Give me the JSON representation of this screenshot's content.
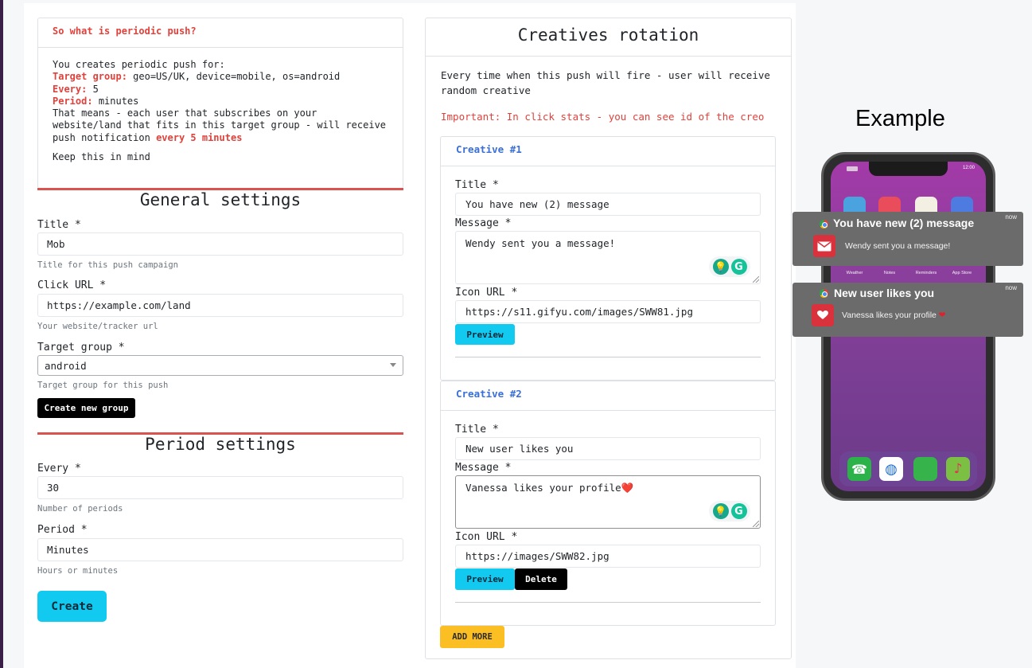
{
  "info": {
    "header": "So what is periodic push?",
    "line1": "You creates periodic push for:",
    "target_label": "Target group:",
    "target_value": "geo=US/UK, device=mobile, os=android",
    "every_label": "Every:",
    "every_value": "5",
    "period_label": "Period:",
    "period_value": "minutes",
    "means_text": "That means - each user that subscribes on your website/land that fits in this target group - will receive push notification",
    "means_highlight": "every 5 minutes",
    "keep": "Keep this in mind"
  },
  "general": {
    "heading": "General settings",
    "title_label": "Title *",
    "title_value": "Mob",
    "title_hint": "Title for this push campaign",
    "url_label": "Click URL *",
    "url_value": "https://example.com/land",
    "url_hint": "Your website/tracker url",
    "group_label": "Target group *",
    "group_value": "android",
    "group_hint": "Target group for this push",
    "create_group_button": "Create new group"
  },
  "period": {
    "heading": "Period settings",
    "every_label": "Every *",
    "every_value": "30",
    "every_hint": "Number of periods",
    "period_label": "Period *",
    "period_value": "Minutes",
    "period_hint": "Hours or minutes",
    "create_button": "Create"
  },
  "rotation": {
    "heading": "Creatives rotation",
    "description": "Every time when this push will fire - user will receive random creative",
    "important": "Important: In click stats - you can see id of the creo",
    "creatives": [
      {
        "header": "Creative #1",
        "title_label": "Title *",
        "title_value": "You have new (2) message",
        "message_label": "Message *",
        "message_value": "Wendy sent you a message!",
        "icon_label": "Icon URL *",
        "icon_value": "https://s11.gifyu.com/images/SWW81.jpg",
        "preview_button": "Preview"
      },
      {
        "header": "Creative #2",
        "title_label": "Title *",
        "title_value": "New user likes you",
        "message_label": "Message *",
        "message_value": "Vanessa likes your profile❤️",
        "icon_label": "Icon URL *",
        "icon_value": "https://images/SWW82.jpg",
        "preview_button": "Preview",
        "delete_button": "Delete"
      }
    ],
    "add_more_button": "ADD MORE"
  },
  "example": {
    "title": "Example",
    "phone_time": "12:00",
    "app_labels": [
      "Weather",
      "Notes",
      "Reminders",
      "App Store"
    ],
    "notifications": [
      {
        "title": "You have new (2) message",
        "message": "Wendy sent you a message!",
        "time": "now",
        "icon": "envelope-icon"
      },
      {
        "title": "New user likes you",
        "message": "Vanessa likes your profile",
        "heart": "❤",
        "time": "now",
        "icon": "heart-icon"
      }
    ]
  },
  "colors": {
    "accent_red": "#e0413b",
    "accent_blue": "#3a6fd8",
    "button_cyan": "#12c9f0",
    "button_yellow": "#fbbf24"
  }
}
